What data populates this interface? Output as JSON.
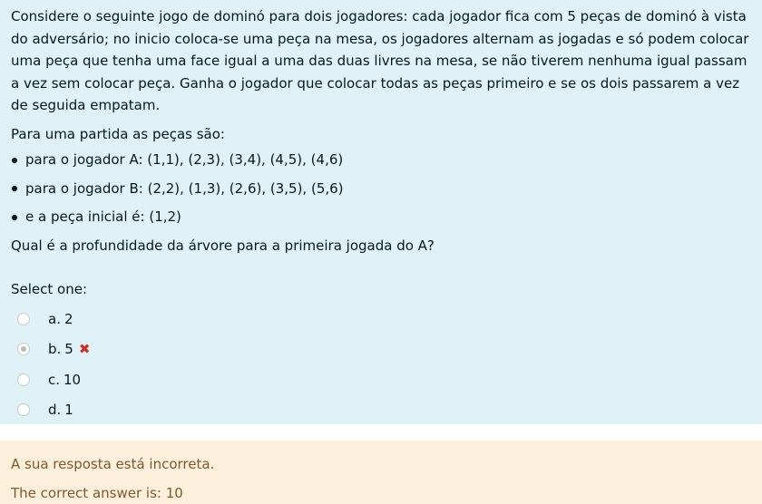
{
  "question": {
    "intro": "Considere o seguinte jogo de dominó para dois jogadores: cada jogador fica com 5 peças de dominó à vista do adversário; no inicio coloca-se uma peça na mesa, os jogadores alternam as jogadas e só podem colocar uma peça que tenha uma face igual a uma das duas livres na mesa, se não tiverem nenhuma igual passam a vez sem colocar peça. Ganha o jogador que colocar todas as peças primeiro e se os dois passarem a vez de seguida empatam.",
    "pieces_title": "Para uma partida as peças são:",
    "pieces": [
      "para o jogador A: (1,1), (2,3), (3,4), (4,5), (4,6)",
      "para o jogador B: (2,2), (1,3), (2,6), (3,5), (5,6)",
      "e a peça inicial é: (1,2)"
    ],
    "prompt": "Qual é a profundidade da árvore para a primeira jogada do A?"
  },
  "answers": {
    "select_label": "Select one:",
    "options": [
      {
        "letter": "a.",
        "value": "2",
        "checked": false,
        "incorrect": false
      },
      {
        "letter": "b.",
        "value": "5",
        "checked": true,
        "incorrect": true
      },
      {
        "letter": "c.",
        "value": "10",
        "checked": false,
        "incorrect": false
      },
      {
        "letter": "d.",
        "value": "1",
        "checked": false,
        "incorrect": false
      }
    ],
    "incorrect_icon": "cross-icon"
  },
  "feedback": {
    "result": "A sua resposta está incorreta.",
    "correct_answer": "The correct answer is: 10"
  },
  "colors": {
    "question_bg": "#def2f8",
    "feedback_bg": "#fcefdc",
    "feedback_text": "#7d5a29",
    "incorrect_icon": "#ca3120"
  }
}
